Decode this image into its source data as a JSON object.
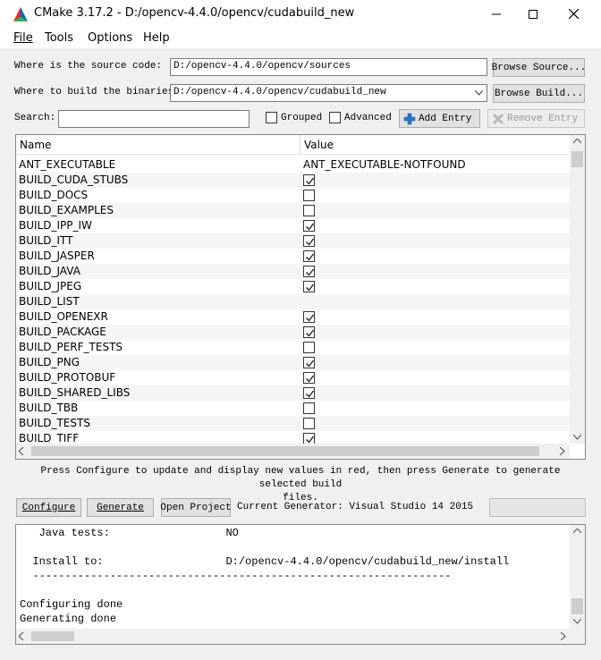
{
  "window": {
    "title": "CMake 3.17.2 - D:/opencv-4.4.0/opencv/cudabuild_new"
  },
  "menu": [
    "File",
    "Tools",
    "Options",
    "Help"
  ],
  "source": {
    "label": "Where is the source code:",
    "value": "D:/opencv-4.4.0/opencv/sources",
    "browse_label": "Browse Source..."
  },
  "build": {
    "label": "Where to build the binaries:",
    "value": "D:/opencv-4.4.0/opencv/cudabuild_new",
    "browse_label": "Browse Build..."
  },
  "search": {
    "label": "Search:",
    "value": "",
    "grouped_label": "Grouped",
    "advanced_label": "Advanced",
    "add_entry_label": "Add Entry",
    "remove_entry_label": "Remove Entry"
  },
  "table": {
    "columns": [
      "Name",
      "Value"
    ],
    "rows": [
      {
        "name": "ANT_EXECUTABLE",
        "value": "ANT_EXECUTABLE-NOTFOUND"
      },
      {
        "name": "BUILD_CUDA_STUBS",
        "checked": true
      },
      {
        "name": "BUILD_DOCS",
        "checked": false
      },
      {
        "name": "BUILD_EXAMPLES",
        "checked": false
      },
      {
        "name": "BUILD_IPP_IW",
        "checked": true
      },
      {
        "name": "BUILD_ITT",
        "checked": true
      },
      {
        "name": "BUILD_JASPER",
        "checked": true
      },
      {
        "name": "BUILD_JAVA",
        "checked": true
      },
      {
        "name": "BUILD_JPEG",
        "checked": true
      },
      {
        "name": "BUILD_LIST",
        "value": ""
      },
      {
        "name": "BUILD_OPENEXR",
        "checked": true
      },
      {
        "name": "BUILD_PACKAGE",
        "checked": true
      },
      {
        "name": "BUILD_PERF_TESTS",
        "checked": false
      },
      {
        "name": "BUILD_PNG",
        "checked": true
      },
      {
        "name": "BUILD_PROTOBUF",
        "checked": true
      },
      {
        "name": "BUILD_SHARED_LIBS",
        "checked": true
      },
      {
        "name": "BUILD_TBB",
        "checked": false
      },
      {
        "name": "BUILD_TESTS",
        "checked": false
      },
      {
        "name": "BUILD_TIFF",
        "checked": true
      }
    ]
  },
  "hint": {
    "line1": "Press Configure to update and display new values in red, then press Generate to generate selected build",
    "line2": "files."
  },
  "actions": {
    "configure_label": "Configure",
    "generate_label": "Generate",
    "open_project_label": "Open Project",
    "generator_text": "Current Generator: Visual Studio 14 2015"
  },
  "output": {
    "lines": [
      "   Java tests:                  NO",
      "",
      "  Install to:                   D:/opencv-4.4.0/opencv/cudabuild_new/install",
      "  -----------------------------------------------------------------",
      "",
      "Configuring done",
      "Generating done"
    ]
  },
  "colors": {
    "accent": "#0078d7",
    "logo_red": "#e8262d",
    "logo_green": "#2bb34a",
    "logo_blue": "#0a66c2"
  }
}
